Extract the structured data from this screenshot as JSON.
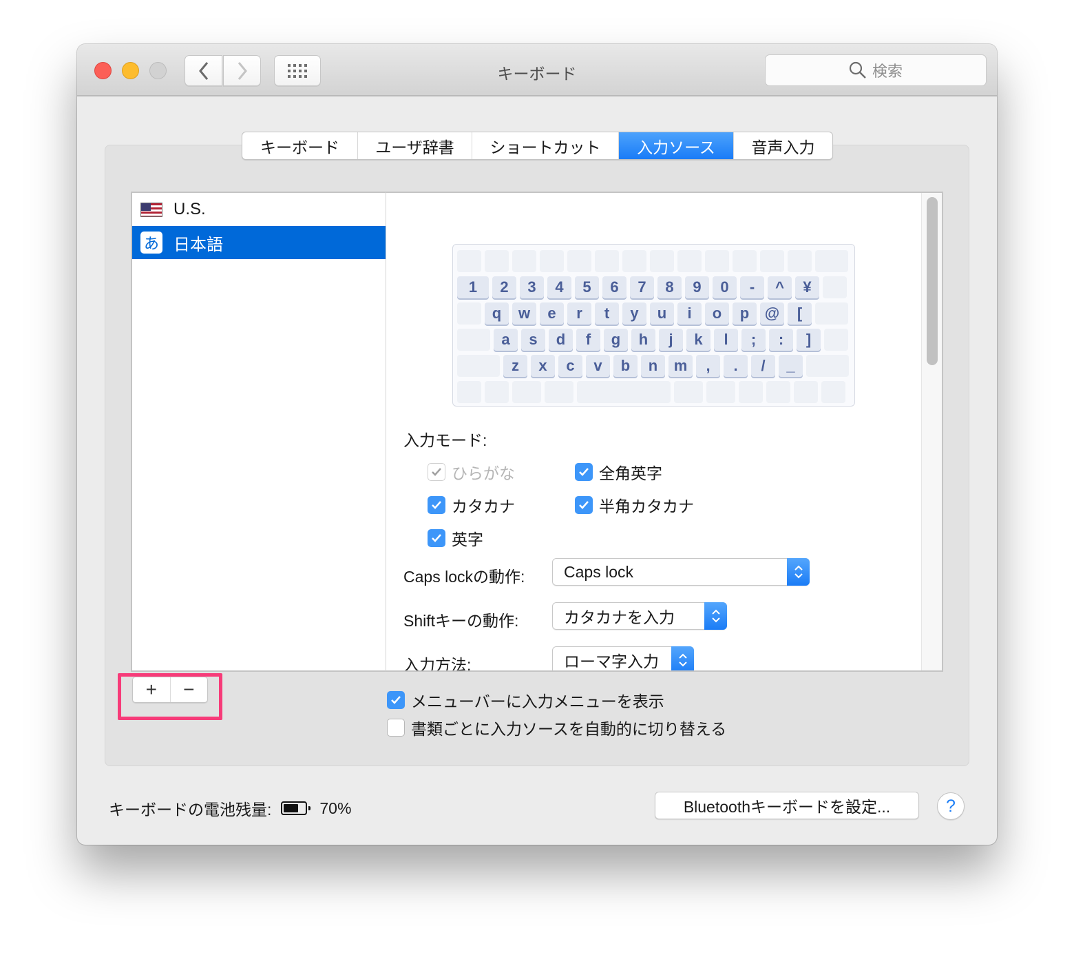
{
  "window": {
    "title": "キーボード",
    "search_placeholder": "検索"
  },
  "tabs": [
    {
      "label": "キーボード",
      "active": false
    },
    {
      "label": "ユーザ辞書",
      "active": false
    },
    {
      "label": "ショートカット",
      "active": false
    },
    {
      "label": "入力ソース",
      "active": true
    },
    {
      "label": "音声入力",
      "active": false
    }
  ],
  "input_sources": [
    {
      "label": "U.S.",
      "icon": "us-flag-icon",
      "selected": false
    },
    {
      "label": "日本語",
      "icon": "hiragana-a-icon",
      "icon_glyph": "あ",
      "selected": true
    }
  ],
  "keyboard_layout": {
    "rows": [
      [],
      [
        "1",
        "2",
        "3",
        "4",
        "5",
        "6",
        "7",
        "8",
        "9",
        "0",
        "-",
        "^",
        "¥"
      ],
      [
        "q",
        "w",
        "e",
        "r",
        "t",
        "y",
        "u",
        "i",
        "o",
        "p",
        "@",
        "["
      ],
      [
        "a",
        "s",
        "d",
        "f",
        "g",
        "h",
        "j",
        "k",
        "l",
        ";",
        ":",
        "]"
      ],
      [
        "z",
        "x",
        "c",
        "v",
        "b",
        "n",
        "m",
        ",",
        ".",
        "/",
        "_"
      ],
      []
    ]
  },
  "input_modes": {
    "label": "入力モード:",
    "options": [
      {
        "label": "ひらがな",
        "checked": true,
        "disabled": true
      },
      {
        "label": "全角英字",
        "checked": true,
        "disabled": false
      },
      {
        "label": "カタカナ",
        "checked": true,
        "disabled": false
      },
      {
        "label": "半角カタカナ",
        "checked": true,
        "disabled": false
      },
      {
        "label": "英字",
        "checked": true,
        "disabled": false
      }
    ]
  },
  "settings": {
    "caps_lock": {
      "label": "Caps lockの動作:",
      "value": "Caps lock"
    },
    "shift": {
      "label": "Shiftキーの動作:",
      "value": "カタカナを入力"
    },
    "input_method": {
      "label": "入力方法:",
      "value": "ローマ字入力"
    }
  },
  "list_buttons": {
    "add": "+",
    "remove": "−"
  },
  "options": [
    {
      "label": "メニューバーに入力メニューを表示",
      "checked": true
    },
    {
      "label": "書類ごとに入力ソースを自動的に切り替える",
      "checked": false
    }
  ],
  "footer": {
    "battery_label": "キーボードの電池残量:",
    "battery_value": "70%",
    "battery_level": 0.7,
    "bluetooth_button": "Bluetoothキーボードを設定...",
    "help": "?"
  },
  "colors": {
    "accent": "#1a7cf7",
    "selection": "#0069d9",
    "highlight_box": "#f73b79"
  }
}
